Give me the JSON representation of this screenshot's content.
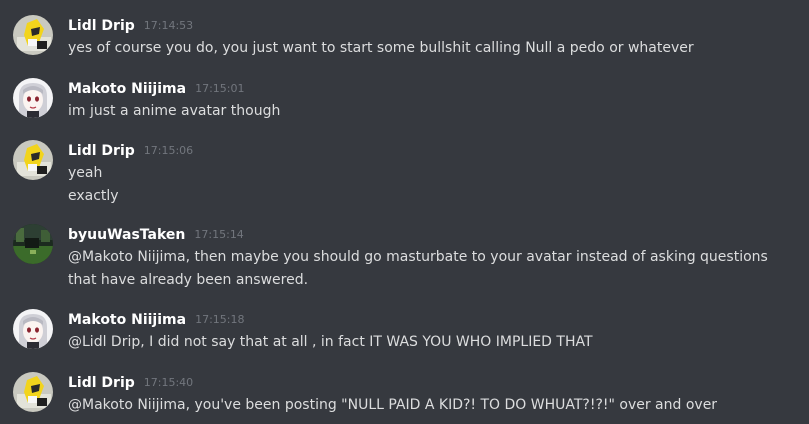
{
  "messages": [
    {
      "author": "Lidl Drip",
      "time": "17:14:53",
      "avatar": "lidl-drip-avatar",
      "lines": [
        "yes of course you do, you just want to start some bullshit calling Null a pedo or whatever"
      ]
    },
    {
      "author": "Makoto Niijima",
      "time": "17:15:01",
      "avatar": "makoto-niijima-avatar",
      "lines": [
        "im just a anime avatar though"
      ]
    },
    {
      "author": "Lidl Drip",
      "time": "17:15:06",
      "avatar": "lidl-drip-avatar",
      "lines": [
        "yeah",
        "exactly"
      ]
    },
    {
      "author": "byuuWasTaken",
      "time": "17:15:14",
      "avatar": "byuuwastaken-avatar",
      "lines": [
        "@Makoto Niijima, then maybe you should go masturbate to your avatar instead of asking questions",
        "that have already been answered."
      ]
    },
    {
      "author": "Makoto Niijima",
      "time": "17:15:18",
      "avatar": "makoto-niijima-avatar",
      "lines": [
        "@Lidl Drip, I did not say that at all , in fact IT WAS YOU WHO IMPLIED THAT"
      ]
    },
    {
      "author": "Lidl Drip",
      "time": "17:15:40",
      "avatar": "lidl-drip-avatar",
      "lines": [
        "@Makoto Niijima, you've been posting \"NULL PAID A KID?! TO DO WHUAT?!?!\" over and over"
      ]
    }
  ],
  "colors": {
    "background": "#36393f",
    "username": "#ffffff",
    "timestamp": "#72767d",
    "message_text": "#dcddde"
  }
}
